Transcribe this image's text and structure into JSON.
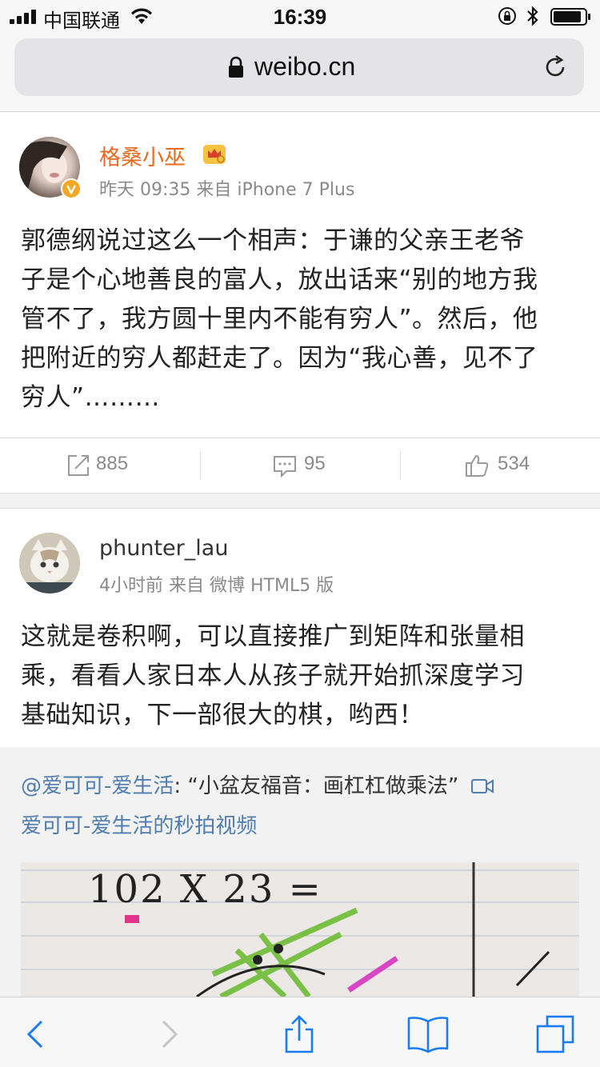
{
  "status_bar": {
    "carrier": "中国联通",
    "time": "16:39"
  },
  "browser": {
    "url": "weibo.cn"
  },
  "posts": [
    {
      "username": "格桑小巫",
      "username_color": "#ea6a1f",
      "meta": "昨天 09:35 来自 iPhone 7 Plus",
      "lines": [
        "郭德纲说过这么一个相声：于谦的父亲王老爷",
        "子是个心地善良的富人，放出话来“别的地方我",
        "管不了，我方圆十里内不能有穷人”。然后，他",
        "把附近的穷人都赶走了。因为“我心善，见不了",
        "穷人”………"
      ],
      "reposts": "885",
      "comments": "95",
      "likes": "534"
    },
    {
      "username": "phunter_lau",
      "username_color": "#333333",
      "meta": "4小时前 来自 微博 HTML5 版",
      "lines": [
        "这就是卷积啊，可以直接推广到矩阵和张量相",
        "乘，看看人家日本人从孩子就开始抓深度学习",
        "基础知识，下一部很大的棋，哟西！"
      ],
      "repost": {
        "author": "@爱可可-爱生活",
        "separator": ": ",
        "quote": "“小盆友福音：画杠杠做乘法”",
        "link_text": "爱可可-爱生活的秒拍视频",
        "video_caption": "102 X 23 ="
      }
    }
  ],
  "colors": {
    "link_blue": "#507daf",
    "icon_gray": "#9a9a9a",
    "ios_blue": "#1a7cf5"
  },
  "icons": [
    "signal-icon",
    "wifi-icon",
    "lock-icon",
    "bluetooth-icon",
    "battery-icon",
    "reload-icon",
    "repost-icon",
    "comment-icon",
    "like-icon",
    "back-icon",
    "forward-icon",
    "share-icon",
    "bookmarks-icon",
    "tabs-icon",
    "video-icon",
    "verified-badge-icon",
    "crown-badge-icon"
  ]
}
